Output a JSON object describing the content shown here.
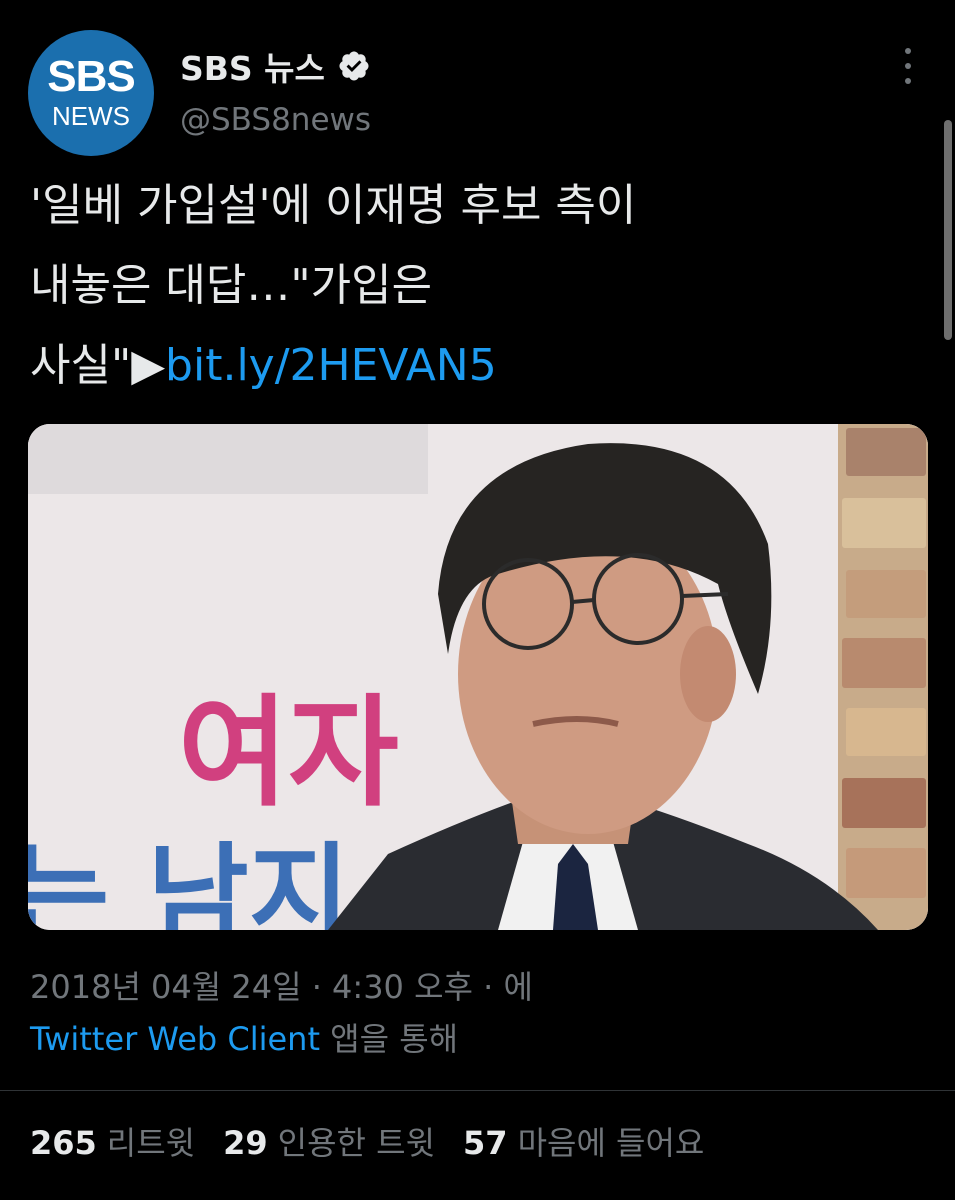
{
  "account": {
    "avatar_line1": "SBS",
    "avatar_line2": "NEWS",
    "display_name": "SBS 뉴스",
    "handle": "@SBS8news"
  },
  "tweet": {
    "line1": "'일베 가입설'에 이재명 후보 측이",
    "line2": "내놓은 대답…\"가입은",
    "line3_prefix": "사실\"▶",
    "link": "bit.ly/2HEVAN5",
    "image_text_pink": "여자",
    "image_text_blue_partial": "는 남지"
  },
  "meta": {
    "timestamp": "2018년 04월 24일 · 4:30 오후 · 에",
    "client": "Twitter Web Client",
    "client_suffix": "앱을 통해"
  },
  "stats": [
    {
      "count": "265",
      "label": "리트윗"
    },
    {
      "count": "29",
      "label": "인용한 트윗"
    },
    {
      "count": "57",
      "label": "마음에 들어요"
    }
  ],
  "colors": {
    "background": "#000000",
    "link": "#1d9bf0",
    "secondary": "#71767b",
    "avatar": "#1b6fae"
  }
}
